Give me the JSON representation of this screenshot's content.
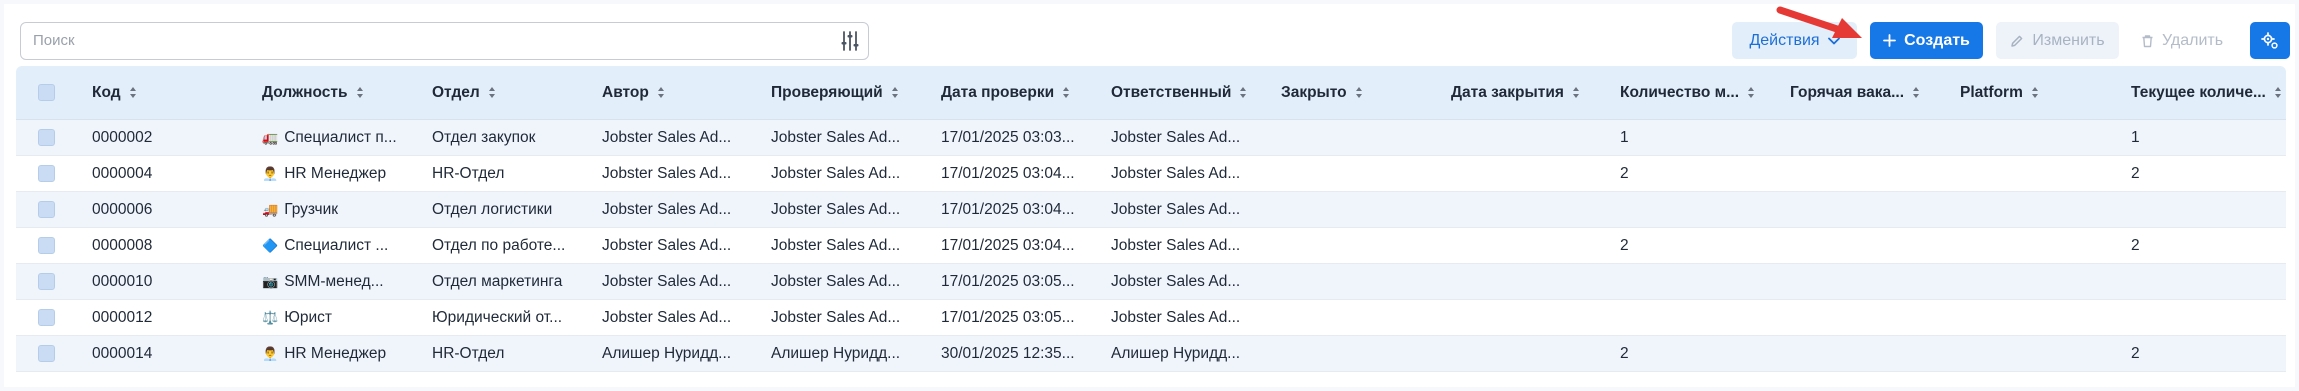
{
  "search": {
    "placeholder": "Поиск",
    "value": ""
  },
  "toolbar": {
    "actions_label": "Действия",
    "create_label": "Создать",
    "edit_label": "Изменить",
    "delete_label": "Удалить"
  },
  "icons": {
    "filter": "sliders-icon",
    "actions_chevron": "chevron-down-icon",
    "create": "plus-icon",
    "edit": "pencil-icon",
    "delete": "trash-icon",
    "settings": "gear-icon",
    "sort": "sort-icon",
    "annotation": "red-arrow"
  },
  "colors": {
    "primary": "#1677e6",
    "header_bg": "#e3eefb",
    "alt_row_bg": "#f0f5fc",
    "arrow": "#e53935"
  },
  "table": {
    "columns": [
      "Код",
      "Должность",
      "Отдел",
      "Автор",
      "Проверяющий",
      "Дата проверки",
      "Ответственный",
      "Закрыто",
      "Дата закрытия",
      "Количество м...",
      "Горячая вака...",
      "Platform",
      "Текущее количе..."
    ],
    "rows": [
      {
        "code": "0000002",
        "emoji": "🚛",
        "position": "Специалист п...",
        "dept": "Отдел закупок",
        "author": "Jobster Sales Ad...",
        "reviewer": "Jobster Sales Ad...",
        "review_date": "17/01/2025 03:03...",
        "responsible": "Jobster Sales Ad...",
        "closed": "",
        "close_date": "",
        "count": "1",
        "hot": "",
        "platform": "",
        "current": "1"
      },
      {
        "code": "0000004",
        "emoji": "👨‍💼",
        "position": "HR Менеджер",
        "dept": "HR-Отдел",
        "author": "Jobster Sales Ad...",
        "reviewer": "Jobster Sales Ad...",
        "review_date": "17/01/2025 03:04...",
        "responsible": "Jobster Sales Ad...",
        "closed": "",
        "close_date": "",
        "count": "2",
        "hot": "",
        "platform": "",
        "current": "2"
      },
      {
        "code": "0000006",
        "emoji": "🚚",
        "position": "Грузчик",
        "dept": "Отдел логистики",
        "author": "Jobster Sales Ad...",
        "reviewer": "Jobster Sales Ad...",
        "review_date": "17/01/2025 03:04...",
        "responsible": "Jobster Sales Ad...",
        "closed": "",
        "close_date": "",
        "count": "",
        "hot": "",
        "platform": "",
        "current": ""
      },
      {
        "code": "0000008",
        "emoji": "🔷",
        "position": "Специалист ...",
        "dept": "Отдел по работе...",
        "author": "Jobster Sales Ad...",
        "reviewer": "Jobster Sales Ad...",
        "review_date": "17/01/2025 03:04...",
        "responsible": "Jobster Sales Ad...",
        "closed": "",
        "close_date": "",
        "count": "2",
        "hot": "",
        "platform": "",
        "current": "2"
      },
      {
        "code": "0000010",
        "emoji": "📷",
        "position": "SMM-менед...",
        "dept": "Отдел маркетинга",
        "author": "Jobster Sales Ad...",
        "reviewer": "Jobster Sales Ad...",
        "review_date": "17/01/2025 03:05...",
        "responsible": "Jobster Sales Ad...",
        "closed": "",
        "close_date": "",
        "count": "",
        "hot": "",
        "platform": "",
        "current": ""
      },
      {
        "code": "0000012",
        "emoji": "⚖️",
        "position": "Юрист",
        "dept": "Юридический от...",
        "author": "Jobster Sales Ad...",
        "reviewer": "Jobster Sales Ad...",
        "review_date": "17/01/2025 03:05...",
        "responsible": "Jobster Sales Ad...",
        "closed": "",
        "close_date": "",
        "count": "",
        "hot": "",
        "platform": "",
        "current": ""
      },
      {
        "code": "0000014",
        "emoji": "👨‍💼",
        "position": "HR Менеджер",
        "dept": "HR-Отдел",
        "author": "Алишер Нуридд...",
        "reviewer": "Алишер Нуридд...",
        "review_date": "30/01/2025 12:35...",
        "responsible": "Алишер Нуридд...",
        "closed": "",
        "close_date": "",
        "count": "2",
        "hot": "",
        "platform": "",
        "current": "2"
      }
    ]
  }
}
